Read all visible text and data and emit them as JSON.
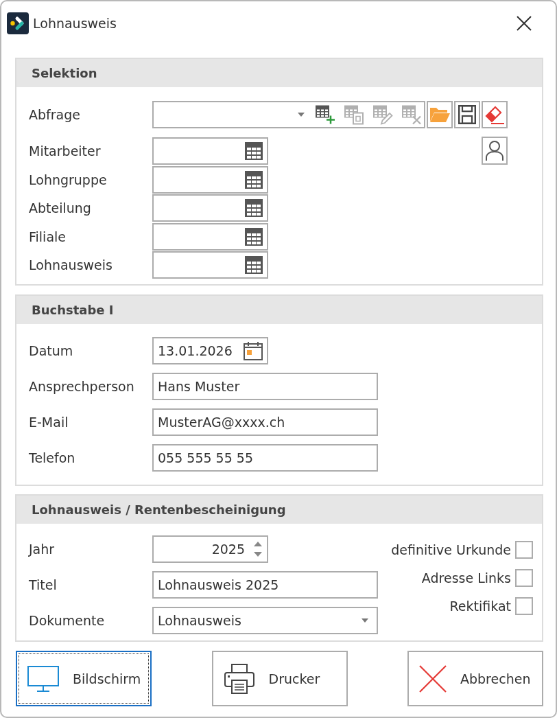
{
  "window": {
    "title": "Lohnausweis"
  },
  "sections": [
    {
      "title": "Selektion",
      "rows": [
        {
          "kind": "query",
          "label": "Abfrage",
          "tools": [
            {
              "kind": "add",
              "disabled": false
            },
            {
              "kind": "copy",
              "disabled": true
            },
            {
              "kind": "edit",
              "disabled": true
            },
            {
              "kind": "delete",
              "disabled": true
            }
          ],
          "buttons": [
            {
              "kind": "open"
            },
            {
              "kind": "save"
            },
            {
              "kind": "clear"
            }
          ]
        },
        {
          "kind": "lookup",
          "label": "Mitarbeiter",
          "person_picker": true
        },
        {
          "kind": "lookup",
          "label": "Lohngruppe",
          "person_picker": false
        },
        {
          "kind": "lookup",
          "label": "Abteilung",
          "person_picker": false
        },
        {
          "kind": "lookup",
          "label": "Filiale",
          "person_picker": false
        },
        {
          "kind": "lookup",
          "label": "Lohnausweis",
          "person_picker": false
        }
      ]
    },
    {
      "title": "Buchstabe I",
      "rows": [
        {
          "kind": "date",
          "label": "Datum",
          "value": "13.01.2026"
        },
        {
          "kind": "text",
          "label": "Ansprechperson",
          "value": "Hans Muster"
        },
        {
          "kind": "text",
          "label": "E-Mail",
          "value": "MusterAG@xxxx.ch"
        },
        {
          "kind": "text",
          "label": "Telefon",
          "value": "055 555 55 55"
        }
      ]
    },
    {
      "title": "Lohnausweis / Rentenbescheinigung",
      "rows": [
        {
          "kind": "spin",
          "label": "Jahr",
          "value": "2025"
        },
        {
          "kind": "text",
          "label": "Titel",
          "value": "Lohnausweis 2025"
        },
        {
          "kind": "select",
          "label": "Dokumente",
          "value": "Lohnausweis"
        }
      ],
      "checkboxes": [
        {
          "label": "definitive Urkunde",
          "checked": false
        },
        {
          "label": "Adresse Links",
          "checked": false
        },
        {
          "label": "Rektifikat",
          "checked": false
        }
      ]
    }
  ],
  "actions": [
    {
      "kind": "screen",
      "label": "Bildschirm",
      "focused": true
    },
    {
      "kind": "print",
      "label": "Drucker",
      "focused": false
    },
    {
      "kind": "cancel",
      "label": "Abbrechen",
      "focused": false
    }
  ]
}
